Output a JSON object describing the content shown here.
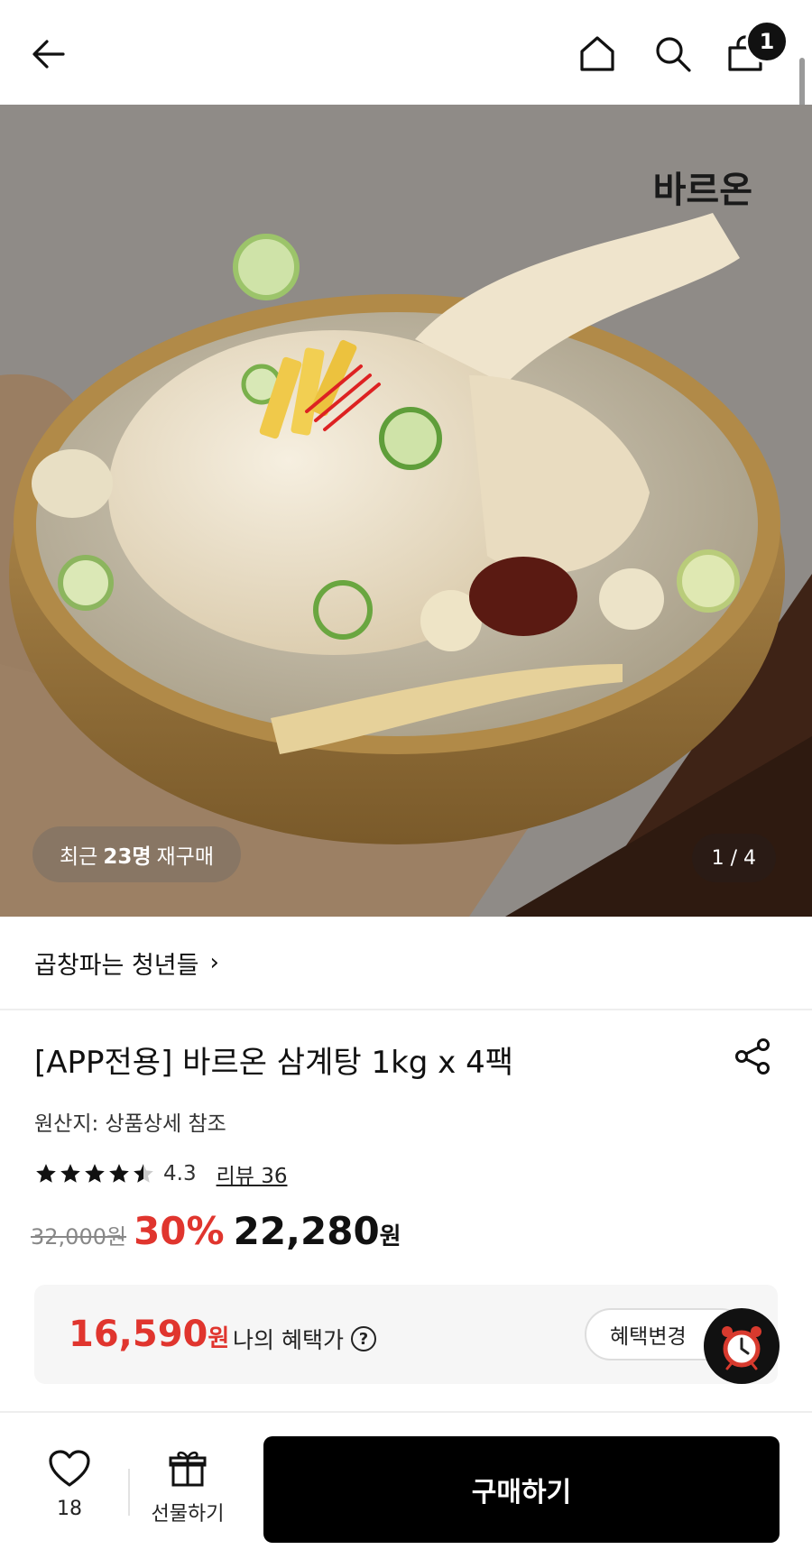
{
  "header": {
    "cart_count": "1"
  },
  "hero": {
    "brand_logo": "바르온",
    "repurchase_prefix": "최근",
    "repurchase_count": "23명",
    "repurchase_suffix": "재구매",
    "pager": "1 / 4"
  },
  "store": {
    "name": "곱창파는 청년들",
    "chevron": "›"
  },
  "product": {
    "title": "[APP전용] 바르온 삼계탕 1kg x 4팩",
    "origin": "원산지: 상품상세 참조",
    "rating": 4.3,
    "rating_text": "4.3",
    "review_link": "리뷰 36",
    "original_price": "32,000원",
    "discount": "30%",
    "sale_price": "22,280",
    "sale_unit": "원"
  },
  "benefit": {
    "price": "16,590",
    "unit": "원",
    "label": "나의 혜택가",
    "help": "?",
    "change_button": "혜택변경"
  },
  "bottom": {
    "wish_count": "18",
    "gift_label": "선물하기",
    "buy_label": "구매하기"
  },
  "colors": {
    "accent_red": "#e0352e",
    "buy_button": "#000000"
  }
}
